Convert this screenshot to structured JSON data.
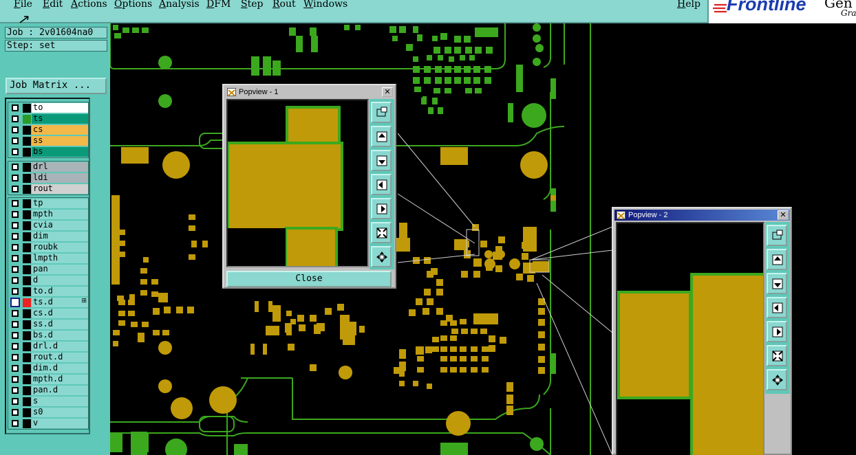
{
  "menubar": {
    "items": [
      "File",
      "Edit",
      "Actions",
      "Options",
      "Analysis",
      "DFM",
      "Step",
      "Rout",
      "Windows"
    ],
    "help": "Help"
  },
  "logo": {
    "brand": "Frontline",
    "text_cut": "Gen",
    "tagline_cut": "Gra"
  },
  "left_panel": {
    "job": "Job : 2v01604na0",
    "step": "Step: set",
    "job_matrix_label": "Job Matrix ..."
  },
  "layer_groups": [
    {
      "layers": [
        {
          "name": "to",
          "swatch": "#000000",
          "label_bg": "#ffffff",
          "checked": false
        },
        {
          "name": "ts",
          "swatch": "#2a9a2a",
          "label_bg": "#0a9a7a",
          "checked": false
        },
        {
          "name": "cs",
          "swatch": "#000000",
          "label_bg": "#f2b84a",
          "checked": false
        },
        {
          "name": "ss",
          "swatch": "#000000",
          "label_bg": "#f2b84a",
          "checked": false
        },
        {
          "name": "bs",
          "swatch": "#000000",
          "label_bg": "#0a9a7a",
          "checked": false
        }
      ]
    },
    {
      "layers": [
        {
          "name": "drl",
          "swatch": "#000000",
          "label_bg": "#a8b4b8",
          "checked": false
        },
        {
          "name": "ldi",
          "swatch": "#000000",
          "label_bg": "#a8b4b8",
          "checked": false
        },
        {
          "name": "rout",
          "swatch": "#000000",
          "label_bg": "#d0d0d0",
          "checked": false
        }
      ]
    },
    {
      "layers": [
        {
          "name": "tp",
          "swatch": "#000000",
          "label_bg": "#8ad8d0",
          "checked": false
        },
        {
          "name": "mpth",
          "swatch": "#000000",
          "label_bg": "#8ad8d0",
          "checked": false
        },
        {
          "name": "cvia",
          "swatch": "#000000",
          "label_bg": "#8ad8d0",
          "checked": false
        },
        {
          "name": "dim",
          "swatch": "#000000",
          "label_bg": "#8ad8d0",
          "checked": false
        },
        {
          "name": "roubk",
          "swatch": "#000000",
          "label_bg": "#8ad8d0",
          "checked": false
        },
        {
          "name": "lmpth",
          "swatch": "#000000",
          "label_bg": "#8ad8d0",
          "checked": false
        },
        {
          "name": "pan",
          "swatch": "#000000",
          "label_bg": "#8ad8d0",
          "checked": false
        },
        {
          "name": "d",
          "swatch": "#000000",
          "label_bg": "#8ad8d0",
          "checked": false
        },
        {
          "name": "to.d",
          "swatch": "#000000",
          "label_bg": "#8ad8d0",
          "checked": false
        },
        {
          "name": "ts.d",
          "swatch": "#ee2222",
          "label_bg": "#8ad8d0",
          "checked": true,
          "has_marker": true
        },
        {
          "name": "cs.d",
          "swatch": "#000000",
          "label_bg": "#8ad8d0",
          "checked": false
        },
        {
          "name": "ss.d",
          "swatch": "#000000",
          "label_bg": "#8ad8d0",
          "checked": false
        },
        {
          "name": "bs.d",
          "swatch": "#000000",
          "label_bg": "#8ad8d0",
          "checked": false
        },
        {
          "name": "drl.d",
          "swatch": "#000000",
          "label_bg": "#8ad8d0",
          "checked": false
        },
        {
          "name": "rout.d",
          "swatch": "#000000",
          "label_bg": "#8ad8d0",
          "checked": false
        },
        {
          "name": "dim.d",
          "swatch": "#000000",
          "label_bg": "#8ad8d0",
          "checked": false
        },
        {
          "name": "mpth.d",
          "swatch": "#000000",
          "label_bg": "#8ad8d0",
          "checked": false
        },
        {
          "name": "pan.d",
          "swatch": "#000000",
          "label_bg": "#8ad8d0",
          "checked": false
        },
        {
          "name": "s",
          "swatch": "#000000",
          "label_bg": "#8ad8d0",
          "checked": false
        },
        {
          "name": "s0",
          "swatch": "#000000",
          "label_bg": "#8ad8d0",
          "checked": false
        },
        {
          "name": "v",
          "swatch": "#000000",
          "label_bg": "#8ad8d0",
          "checked": false
        }
      ]
    }
  ],
  "popview1": {
    "title": "Popview - 1",
    "close_label": "Close"
  },
  "popview2": {
    "title": "Popview - 2"
  },
  "colors": {
    "pad": "#c09a08",
    "copper_outline": "#3ca81e",
    "panel": "#5fc8b8",
    "menubar": "#8ad8d0",
    "brand": "#1a3cb0"
  }
}
